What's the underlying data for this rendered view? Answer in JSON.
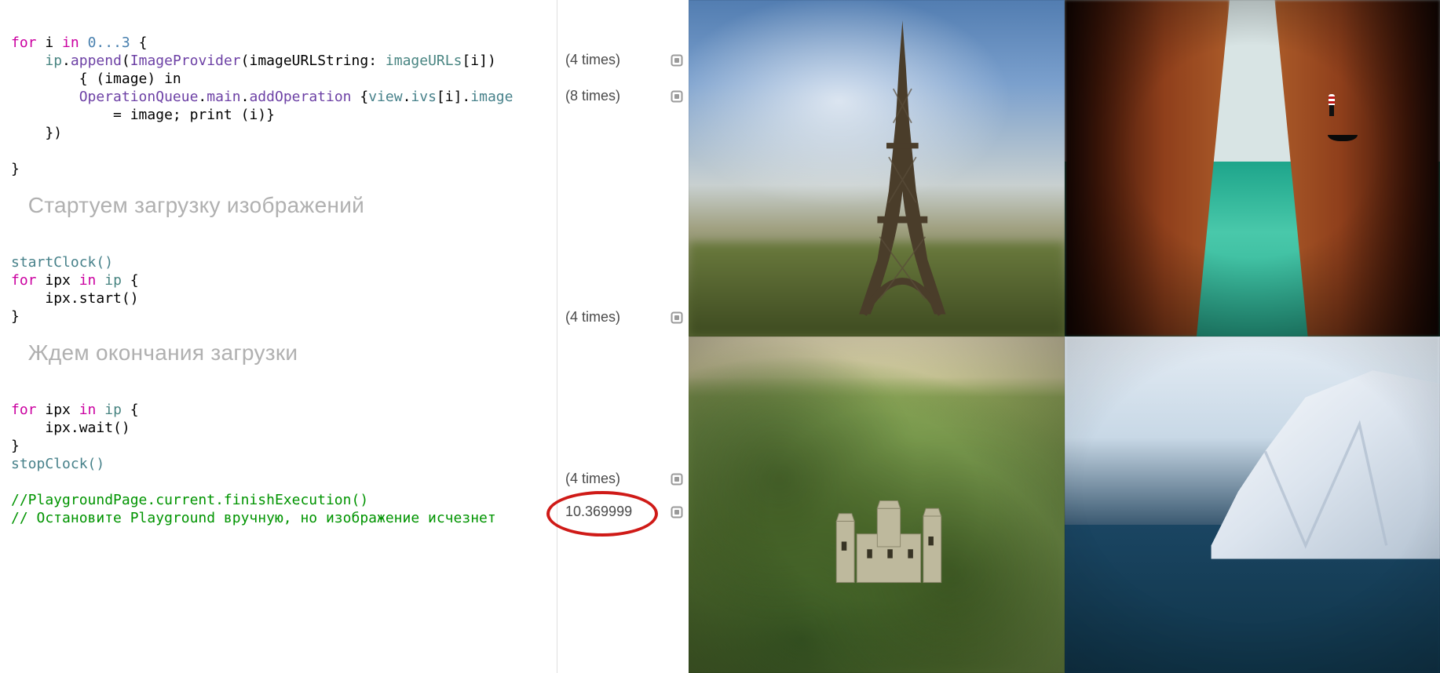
{
  "code": {
    "for_kw": "for",
    "in_kw": "in",
    "range": "0...3",
    "lbrace": "{",
    "ip": "ip",
    "dot": ".",
    "append": "append",
    "imgprov": "ImageProvider",
    "arglabel": "imageURLString:",
    "imageURLs": "imageURLs",
    "sub_i": "[i]",
    "rparen": ")",
    "closure_hdr": "{ (image) in",
    "opq": "OperationQueue",
    "main": "main",
    "addOp": "addOperation",
    "viewexpr": "view",
    "ivsexpr": "ivs",
    "imageprop": "image",
    "assign_line": "= image; print (i)}",
    "close_paren": "})",
    "rbrace": "}",
    "section1": "Стартуем загрузку изображений",
    "startClock": "startClock()",
    "for2_var": "ipx",
    "for2_in_coll": "ip",
    "ipx_start": "ipx.start()",
    "section2": "Ждем окончания загрузки",
    "ipx_wait": "ipx.wait()",
    "stopClock": "stopClock()",
    "comment1": "//PlaygroundPage.current.finishExecution()",
    "comment2": "// Остановите Playground вручную, но изображение исчезнет"
  },
  "results": {
    "r1": "(4 times)",
    "r2": "(8 times)",
    "r3": "(4 times)",
    "r4": "(4 times)",
    "r5": "10.369999"
  },
  "preview": {
    "tiles": [
      "eiffel-tower",
      "venice-canal",
      "castle-hill",
      "iceberg"
    ]
  }
}
